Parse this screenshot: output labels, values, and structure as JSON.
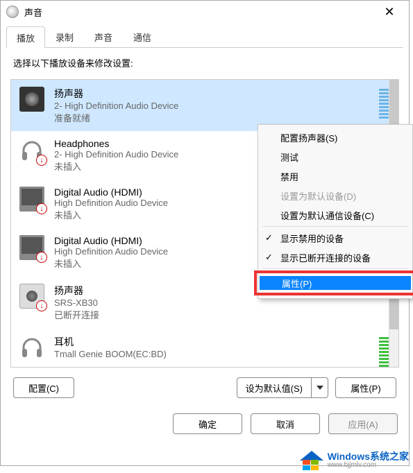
{
  "window": {
    "title": "声音"
  },
  "tabs": [
    "播放",
    "录制",
    "声音",
    "通信"
  ],
  "active_tab": 0,
  "instruction": "选择以下播放设备来修改设置:",
  "devices": [
    {
      "name": "扬声器",
      "line2": "2- High Definition Audio Device",
      "line3": "准备就绪",
      "icon": "speaker",
      "selected": true,
      "level": "blue",
      "badge": false
    },
    {
      "name": "Headphones",
      "line2": "2- High Definition Audio Device",
      "line3": "未插入",
      "icon": "headphones",
      "selected": false,
      "level": null,
      "badge": true
    },
    {
      "name": "Digital Audio (HDMI)",
      "line2": "High Definition Audio Device",
      "line3": "未插入",
      "icon": "monitor",
      "selected": false,
      "level": null,
      "badge": true
    },
    {
      "name": "Digital Audio (HDMI)",
      "line2": "High Definition Audio Device",
      "line3": "未插入",
      "icon": "monitor",
      "selected": false,
      "level": null,
      "badge": true
    },
    {
      "name": "扬声器",
      "line2": "SRS-XB30",
      "line3": "已断开连接",
      "icon": "speaker-box",
      "selected": false,
      "level": null,
      "badge": true
    },
    {
      "name": "耳机",
      "line2": "Tmall Genie BOOM(EC:BD)",
      "line3": "",
      "icon": "headphones",
      "selected": false,
      "level": "green",
      "badge": false
    }
  ],
  "buttons": {
    "configure": "配置(C)",
    "set_default": "设为默认值(S)",
    "properties": "属性(P)",
    "ok": "确定",
    "cancel": "取消",
    "apply": "应用(A)"
  },
  "context_menu": {
    "items": [
      {
        "label": "配置扬声器(S)",
        "disabled": false,
        "checked": false
      },
      {
        "label": "测试",
        "disabled": false,
        "checked": false
      },
      {
        "label": "禁用",
        "disabled": false,
        "checked": false
      },
      {
        "label": "设置为默认设备(D)",
        "disabled": true,
        "checked": false
      },
      {
        "label": "设置为默认通信设备(C)",
        "disabled": false,
        "checked": false
      },
      {
        "sep": true
      },
      {
        "label": "显示禁用的设备",
        "disabled": false,
        "checked": true
      },
      {
        "label": "显示已断开连接的设备",
        "disabled": false,
        "checked": true
      },
      {
        "sep": true
      },
      {
        "label": "属性(P)",
        "disabled": false,
        "checked": false,
        "highlighted": true
      }
    ]
  },
  "watermark": {
    "line1": "Windows系统之家",
    "line2": "www.bjjmlv.com"
  }
}
